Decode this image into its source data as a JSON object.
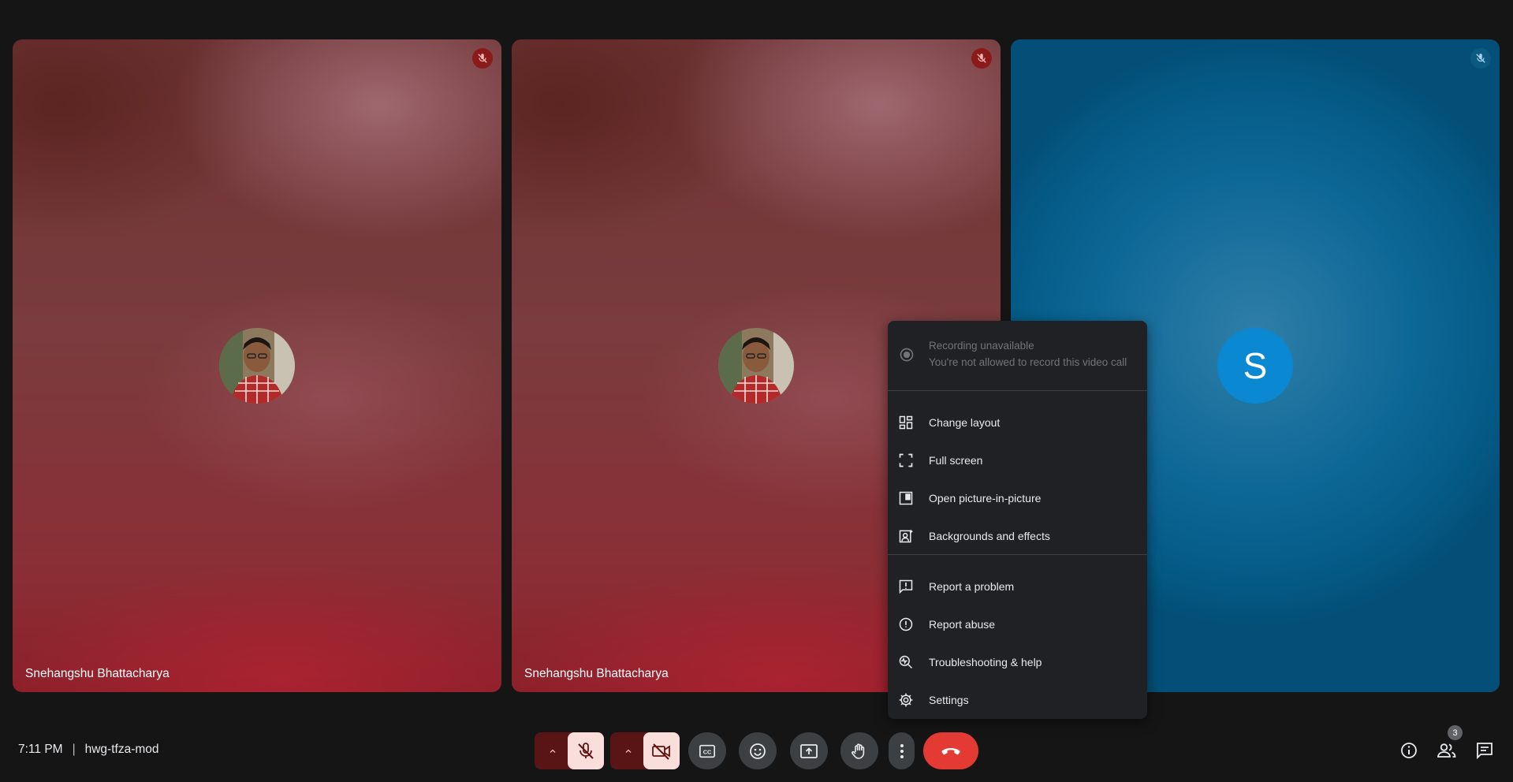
{
  "tiles": [
    {
      "name": "Snehangshu Bhattacharya",
      "avatar_icon": "participant-photo",
      "mic_icon": "mic-off-icon"
    },
    {
      "name": "Snehangshu Bhattacharya",
      "avatar_icon": "participant-photo",
      "mic_icon": "mic-off-icon"
    },
    {
      "name": "",
      "avatar_letter": "S",
      "mic_icon": "mic-off-icon"
    }
  ],
  "menu": {
    "recording": {
      "title": "Recording unavailable",
      "subtitle": "You're not allowed to record this video call",
      "icon": "record-icon"
    },
    "items": [
      {
        "label": "Change layout",
        "icon": "layout-icon"
      },
      {
        "label": "Full screen",
        "icon": "fullscreen-icon"
      },
      {
        "label": "Open picture-in-picture",
        "icon": "picture-in-picture-icon"
      },
      {
        "label": "Backgrounds and effects",
        "icon": "backgrounds-icon"
      },
      {
        "label": "Report a problem",
        "icon": "report-problem-icon"
      },
      {
        "label": "Report abuse",
        "icon": "report-abuse-icon"
      },
      {
        "label": "Troubleshooting & help",
        "icon": "troubleshooting-icon"
      },
      {
        "label": "Settings",
        "icon": "settings-icon"
      }
    ]
  },
  "meeting": {
    "time": "7:11 PM",
    "separator": "|",
    "code": "hwg-tfza-mod"
  },
  "people_count": "3",
  "colors": {
    "end_call": "#e33a33",
    "muted_bg": "#591515",
    "muted_toggle": "#f9dedc",
    "menu_bg": "#202124",
    "avatar_s": "#0b88d2"
  }
}
